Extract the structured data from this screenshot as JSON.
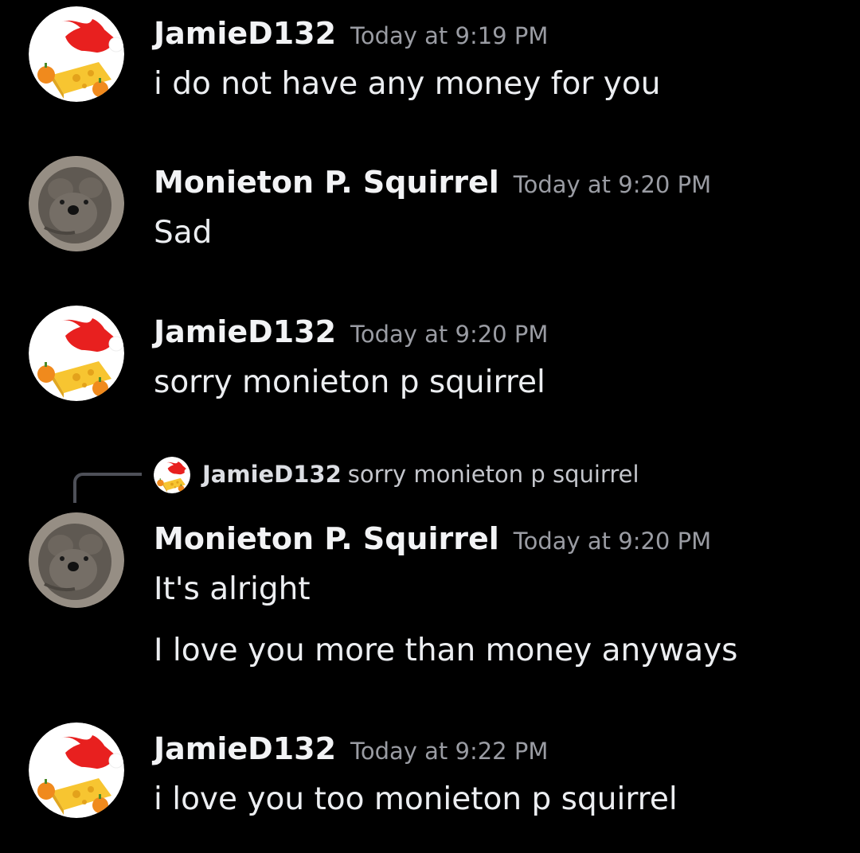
{
  "messages": [
    {
      "author": "JamieD132",
      "timestamp": "Today at 9:19 PM",
      "avatar_icon": "santa-hat-cheese-icon",
      "lines": [
        "i do not have any money for you"
      ]
    },
    {
      "author": "Monieton P. Squirrel",
      "timestamp": "Today at 9:20 PM",
      "avatar_icon": "plush-animal-avatar",
      "lines": [
        "Sad"
      ]
    },
    {
      "author": "JamieD132",
      "timestamp": "Today at 9:20 PM",
      "avatar_icon": "santa-hat-cheese-icon",
      "lines": [
        "sorry monieton p squirrel"
      ]
    },
    {
      "author": "Monieton P. Squirrel",
      "timestamp": "Today at 9:20 PM",
      "avatar_icon": "plush-animal-avatar",
      "reply_to": {
        "author": "JamieD132",
        "text": "sorry monieton p squirrel"
      },
      "lines": [
        "It's alright",
        "I love you more than money anyways"
      ]
    },
    {
      "author": "JamieD132",
      "timestamp": "Today at 9:22 PM",
      "avatar_icon": "santa-hat-cheese-icon",
      "lines": [
        "i love you too monieton p squirrel"
      ]
    }
  ],
  "colors": {
    "background": "#000000",
    "username": "#f2f3f5",
    "timestamp": "#9a9ca3",
    "message_text": "#eceef1",
    "reply_spine": "#4e5058"
  }
}
